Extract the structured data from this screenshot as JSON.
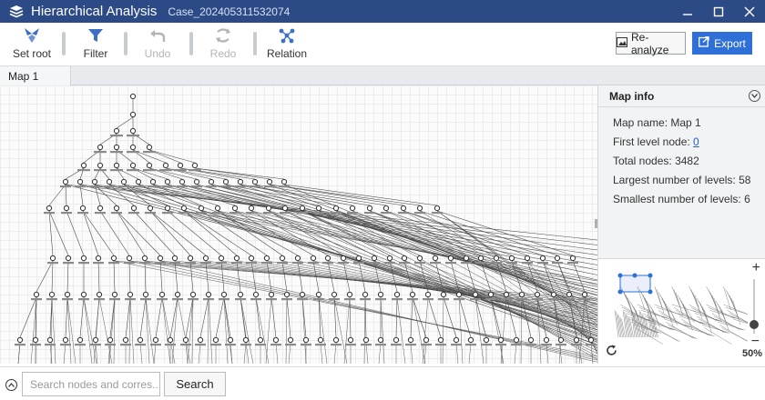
{
  "window": {
    "app_title": "Hierarchical Analysis",
    "case_name": "Case_202405311532074",
    "icon": "hierarchy-icon"
  },
  "toolbar": {
    "set_root": {
      "label": "Set root",
      "icon": "set-root-icon",
      "enabled": true
    },
    "filter": {
      "label": "Filter",
      "icon": "filter-icon",
      "enabled": true
    },
    "undo": {
      "label": "Undo",
      "icon": "undo-icon",
      "enabled": false
    },
    "redo": {
      "label": "Redo",
      "icon": "redo-icon",
      "enabled": false
    },
    "relation": {
      "label": "Relation",
      "icon": "relation-icon",
      "enabled": true
    },
    "reanalyze": {
      "label": "Re-analyze",
      "icon": "image-icon"
    },
    "export": {
      "label": "Export",
      "icon": "export-icon"
    }
  },
  "tabs": [
    {
      "label": "Map 1",
      "active": true
    }
  ],
  "map_info": {
    "title": "Map info",
    "map_name_label": "Map name:",
    "map_name": "Map 1",
    "first_level_label": "First level node:",
    "first_level_value": "0",
    "total_nodes_label": "Total nodes:",
    "total_nodes_value": "3482",
    "largest_levels_label": "Largest number of levels:",
    "largest_levels_value": "58",
    "smallest_levels_label": "Smallest number of levels:",
    "smallest_levels_value": "6"
  },
  "minimap": {
    "zoom_in": "+",
    "zoom_out": "−",
    "zoom_percent": "50%",
    "zoom_fraction": 0.5
  },
  "search": {
    "placeholder": "Search nodes and corres...",
    "value": "",
    "button_label": "Search"
  },
  "colors": {
    "titlebar": "#2c4a86",
    "accent": "#2f6fd8",
    "node_stroke": "#333333"
  }
}
